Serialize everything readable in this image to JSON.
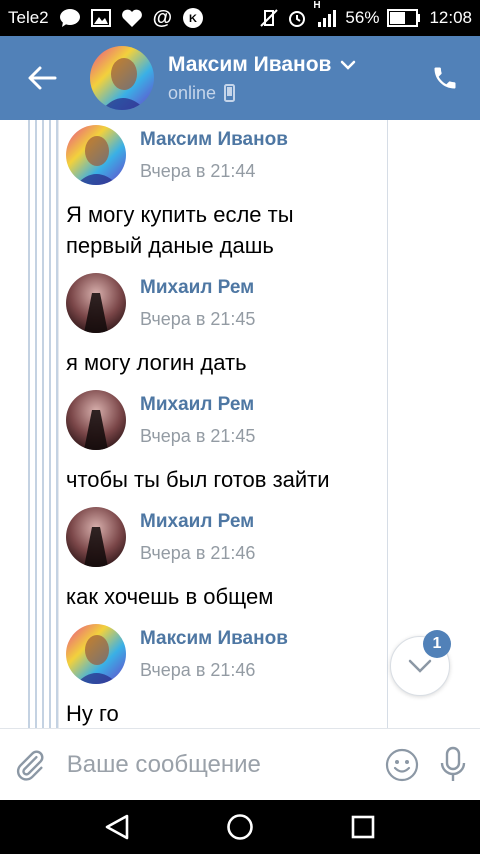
{
  "status_bar": {
    "carrier": "Tele2",
    "network": "H",
    "battery": "56%",
    "time": "12:08"
  },
  "header": {
    "contact_name": "Максим Иванов",
    "status": "online"
  },
  "messages": [
    {
      "author": "Максим Иванов",
      "time": "Вчера в 21:44",
      "lines": [
        "Я могу купить есле ты",
        "первый даные дашь"
      ],
      "avatar": "avatar-maksim"
    },
    {
      "author": "Михаил Рем",
      "time": "Вчера в 21:45",
      "lines": [
        "я могу логин дать"
      ],
      "avatar": "avatar-mikhail"
    },
    {
      "author": "Михаил Рем",
      "time": "Вчера в 21:45",
      "lines": [
        "чтобы ты был готов зайти"
      ],
      "avatar": "avatar-mikhail"
    },
    {
      "author": "Михаил Рем",
      "time": "Вчера в 21:46",
      "lines": [
        "как хочешь в общем"
      ],
      "avatar": "avatar-mikhail"
    },
    {
      "author": "Максим Иванов",
      "time": "Вчера в 21:46",
      "lines": [
        "Ну го"
      ],
      "avatar": "avatar-maksim"
    }
  ],
  "scroll_down": {
    "unread_count": "1"
  },
  "composer": {
    "placeholder": "Ваше сообщение"
  },
  "colors": {
    "header": "#5181b8",
    "name": "#4e77a3",
    "time": "#939ba3"
  },
  "icons": [
    "arrow-back-icon",
    "chevron-down-icon",
    "phone-icon",
    "paperclip-icon",
    "smiley-icon",
    "microphone-icon",
    "nav-back-icon",
    "nav-home-icon",
    "nav-recents-icon"
  ]
}
